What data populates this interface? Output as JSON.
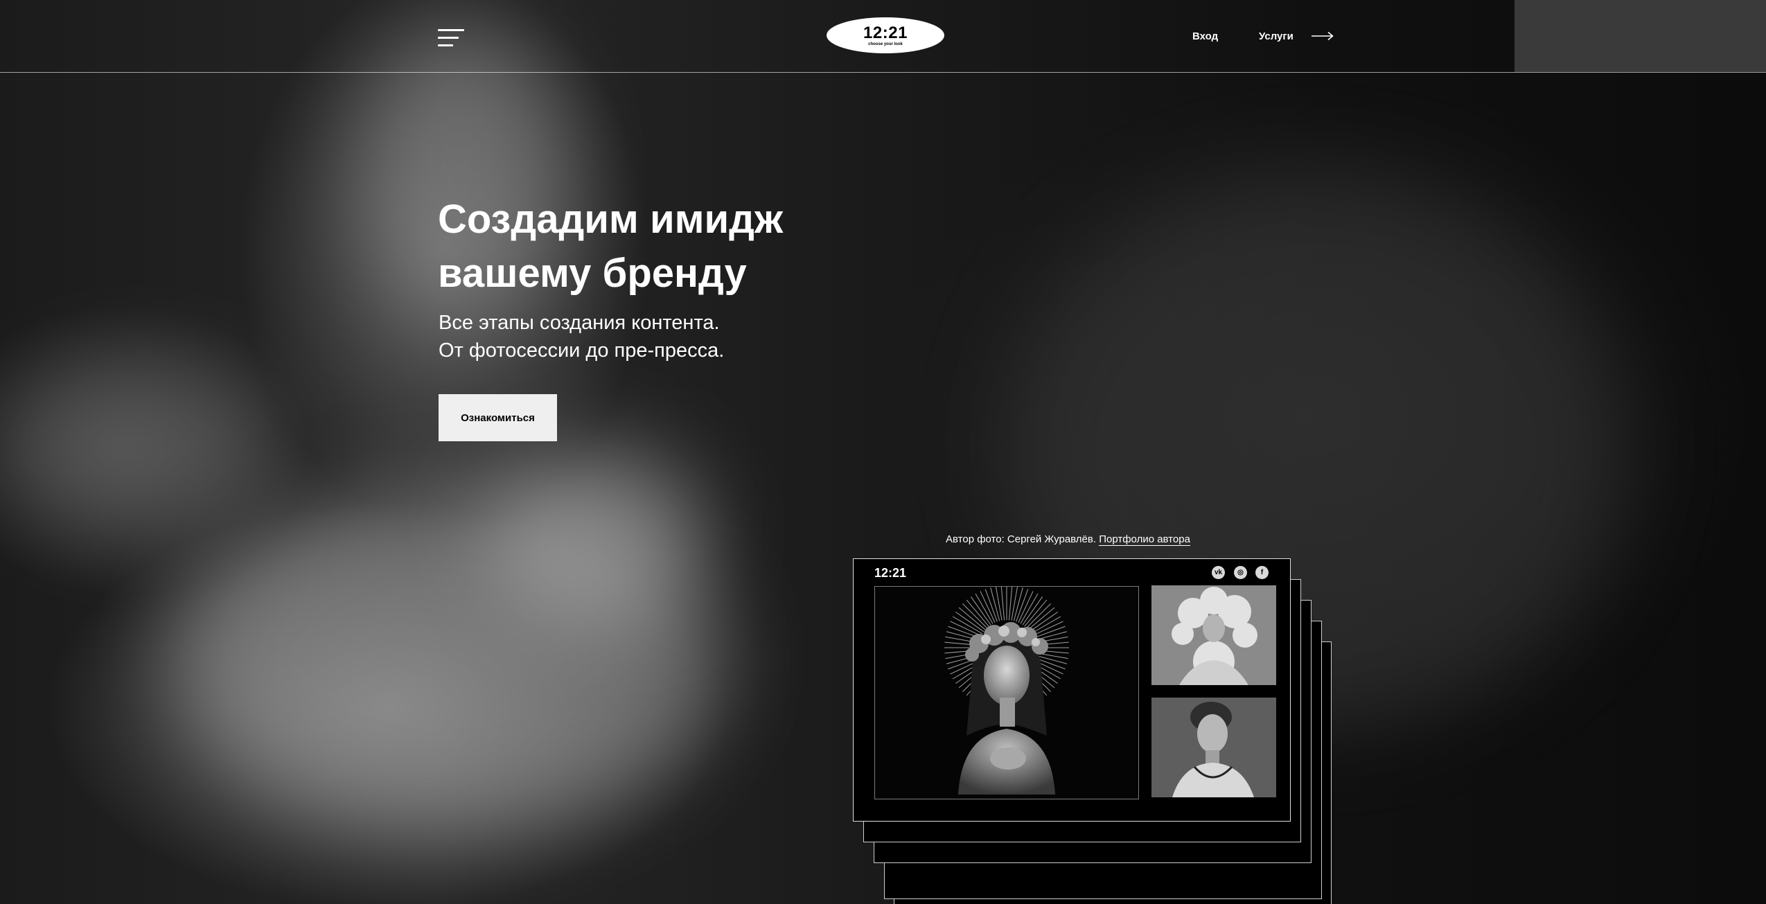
{
  "header": {
    "menu_icon": "hamburger-menu-icon",
    "logo": {
      "main": "12:21",
      "tagline": "choose your look"
    },
    "nav": {
      "login": "Вход",
      "services": "Услуги"
    },
    "arrow_icon": "arrow-right-icon"
  },
  "hero": {
    "title_line1": "Создадим имидж",
    "title_line2": "вашему бренду",
    "subtitle_line1": "Все этапы создания контента.",
    "subtitle_line2": "От фотосессии до пре-пресса.",
    "cta_label": "Ознакомиться"
  },
  "credit": {
    "text": "Автор фото: Сергей Журавлёв.",
    "link": "Портфолио автора"
  },
  "showcase": {
    "logo": "12:21",
    "social_icons": [
      "vk-icon",
      "instagram-icon",
      "facebook-icon"
    ],
    "social_glyphs": [
      "vk",
      "◎",
      "f"
    ]
  },
  "colors": {
    "background": "#121212",
    "accent": "#ffffff",
    "button_bg": "#efefef"
  }
}
